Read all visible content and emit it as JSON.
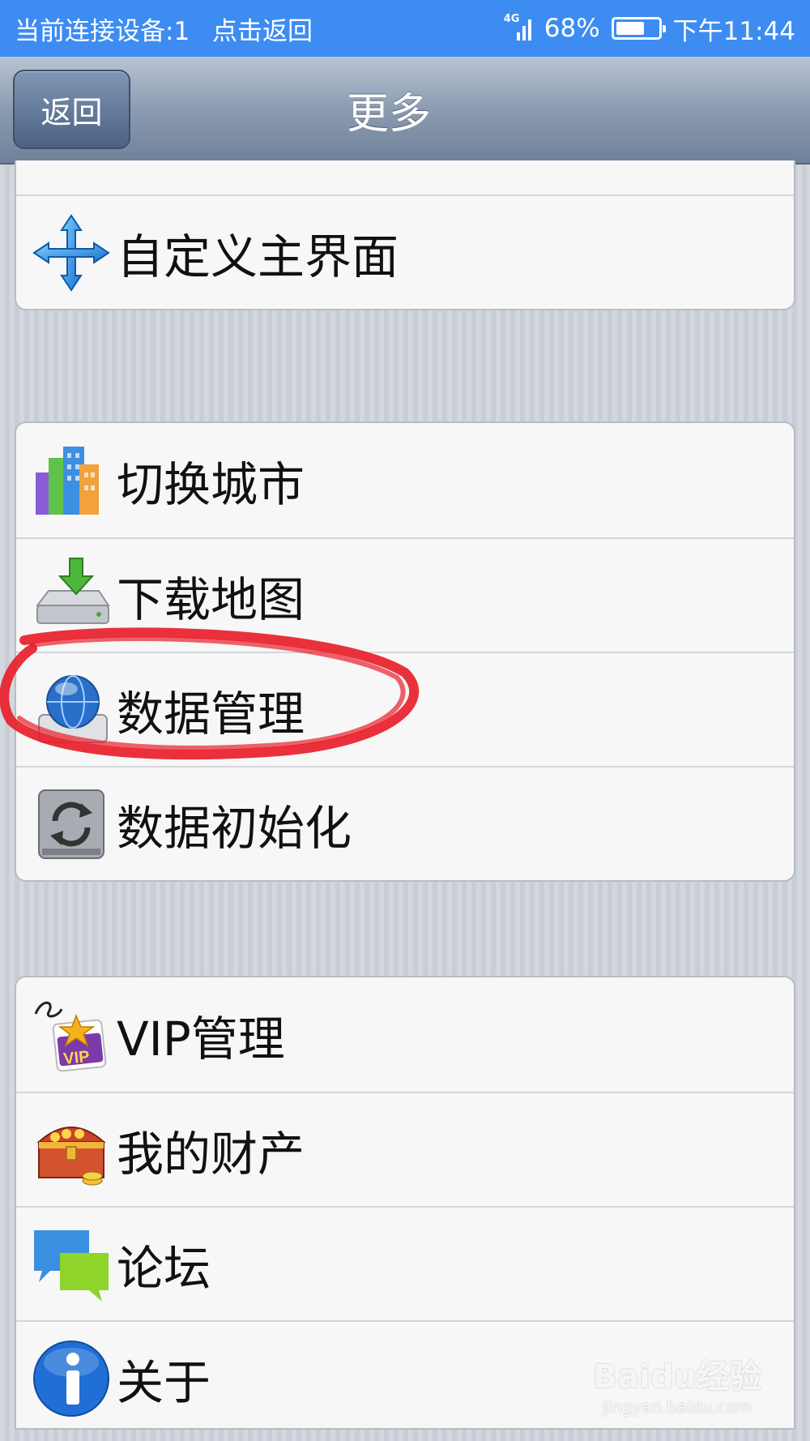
{
  "status_bar": {
    "connection_text": "当前连接设备:1",
    "return_text": "点击返回",
    "network": "4G",
    "battery": "68%",
    "battery_level": 0.68,
    "time": "下午11:44"
  },
  "nav": {
    "back_label": "返回",
    "title": "更多"
  },
  "groups": [
    {
      "items": [
        {
          "label": "自定义主界面",
          "icon": "arrows-move-icon"
        }
      ]
    },
    {
      "items": [
        {
          "label": "切换城市",
          "icon": "city-buildings-icon"
        },
        {
          "label": "下载地图",
          "icon": "download-drive-icon"
        },
        {
          "label": "数据管理",
          "icon": "globe-drive-icon",
          "highlighted": true
        },
        {
          "label": "数据初始化",
          "icon": "refresh-drive-icon"
        }
      ]
    },
    {
      "items": [
        {
          "label": "VIP管理",
          "icon": "vip-star-icon"
        },
        {
          "label": "我的财产",
          "icon": "treasure-chest-icon"
        },
        {
          "label": "论坛",
          "icon": "chat-bubbles-icon"
        },
        {
          "label": "关于",
          "icon": "info-icon"
        }
      ]
    }
  ],
  "highlight_color": "#e8202a",
  "watermark": {
    "text": "Baidu经验",
    "sub": "jingyan.baidu.com"
  }
}
